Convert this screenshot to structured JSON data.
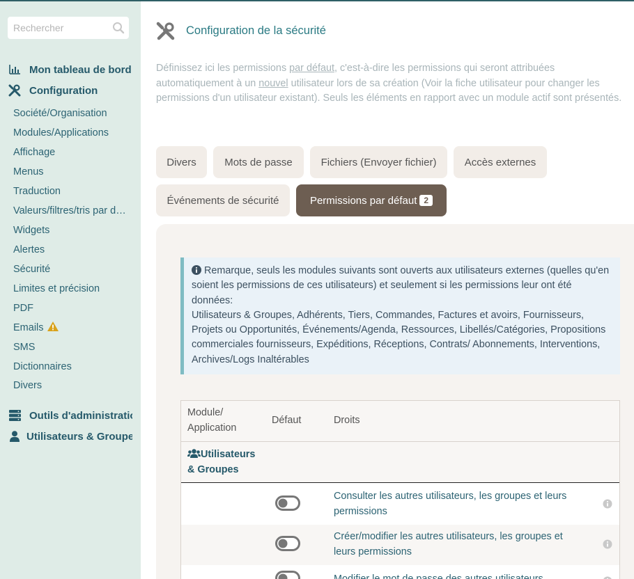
{
  "sidebar": {
    "search_placeholder": "Rechercher",
    "dashboard": "Mon tableau de bord",
    "configuration": "Configuration",
    "items": [
      "Société/Organisation",
      "Modules/Applications",
      "Affichage",
      "Menus",
      "Traduction",
      "Valeurs/filtres/tris par défaut",
      "Widgets",
      "Alertes",
      "Sécurité",
      "Limites et précision",
      "PDF",
      "Emails",
      "SMS",
      "Dictionnaires",
      "Divers"
    ],
    "admin_tools": "Outils d'administration",
    "users_groups": "Utilisateurs & Groupes"
  },
  "header": {
    "title": "Configuration de la sécurité"
  },
  "intro": {
    "part1": "Définissez ici les permissions ",
    "u1": "par défaut",
    "part2": ", c'est-à-dire les permissions qui seront attribuées automatiquement à un ",
    "u2": "nouvel",
    "part3": " utilisateur lors de sa création (Voir la fiche utilisateur pour changer les permissions d'un utilisateur existant). Seuls les éléments en rapport avec un module actif sont présentés."
  },
  "tabs": [
    {
      "label": "Divers"
    },
    {
      "label": "Mots de passe"
    },
    {
      "label": "Fichiers (Envoyer fichier)"
    },
    {
      "label": "Accès externes"
    },
    {
      "label": "Événements de sécurité"
    },
    {
      "label": "Permissions par défaut",
      "badge": "2",
      "active": true
    }
  ],
  "note": {
    "text": "Remarque, seuls les modules suivants sont ouverts aux utilisateurs externes (quelles qu'en soient les permissions de ces utilisateurs) et seulement si les permissions leur ont été données:",
    "modules": "Utilisateurs & Groupes, Adhérents, Tiers, Commandes, Factures et avoirs, Fournisseurs, Projets ou Opportunités, Événements/Agenda, Ressources, Libellés/Catégories, Propositions commerciales fournisseurs, Expéditions, Réceptions, Contrats/ Abonnements, Interventions, Archives/Logs Inaltérables"
  },
  "table": {
    "col_module": "Module/ Application",
    "col_default": "Défaut",
    "col_rights": "Droits",
    "group": "Utilisateurs & Groupes",
    "rows": [
      {
        "text": "Consulter les autres utilisateurs, les groupes et leurs permissions",
        "enabled": false
      },
      {
        "text": "Créer/modifier les autres utilisateurs, les groupes et leurs permissions",
        "enabled": false
      },
      {
        "text": "Modifier le mot de passe des autres utilisateurs",
        "enabled": false
      }
    ]
  },
  "colors": {
    "sidebar_bg": "#dfece7",
    "accent": "#2a7a83",
    "active_tab": "#6d5e52",
    "warning": "#d9a21b"
  }
}
